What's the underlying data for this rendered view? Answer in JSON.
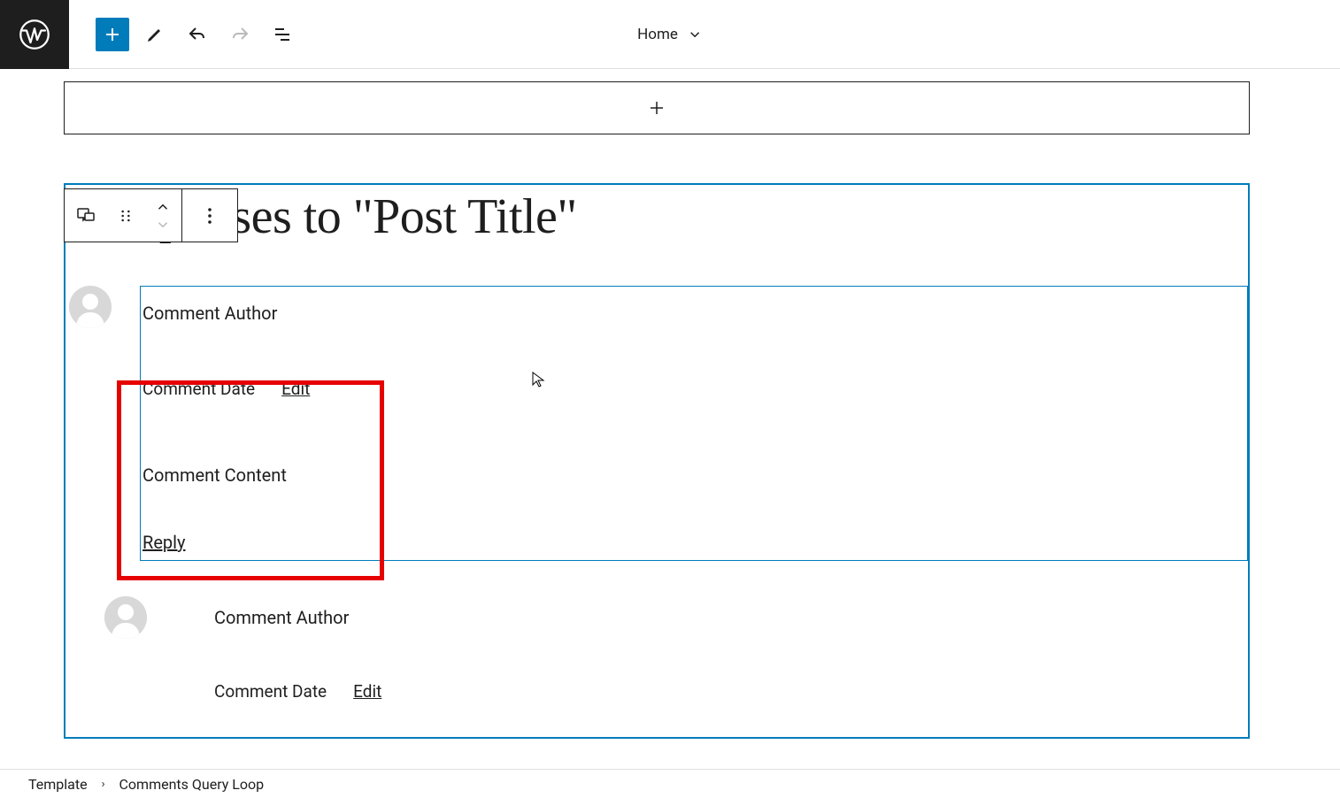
{
  "header": {
    "page_label": "Home"
  },
  "comments_block": {
    "title": "3 responses to \"Post Title\"",
    "comments": [
      {
        "author": "Comment Author",
        "date": "Comment Date",
        "edit": "Edit",
        "content": "Comment Content",
        "reply": "Reply"
      },
      {
        "author": "Comment Author",
        "date": "Comment Date",
        "edit": "Edit"
      }
    ]
  },
  "breadcrumb": {
    "root": "Template",
    "current": "Comments Query Loop"
  }
}
